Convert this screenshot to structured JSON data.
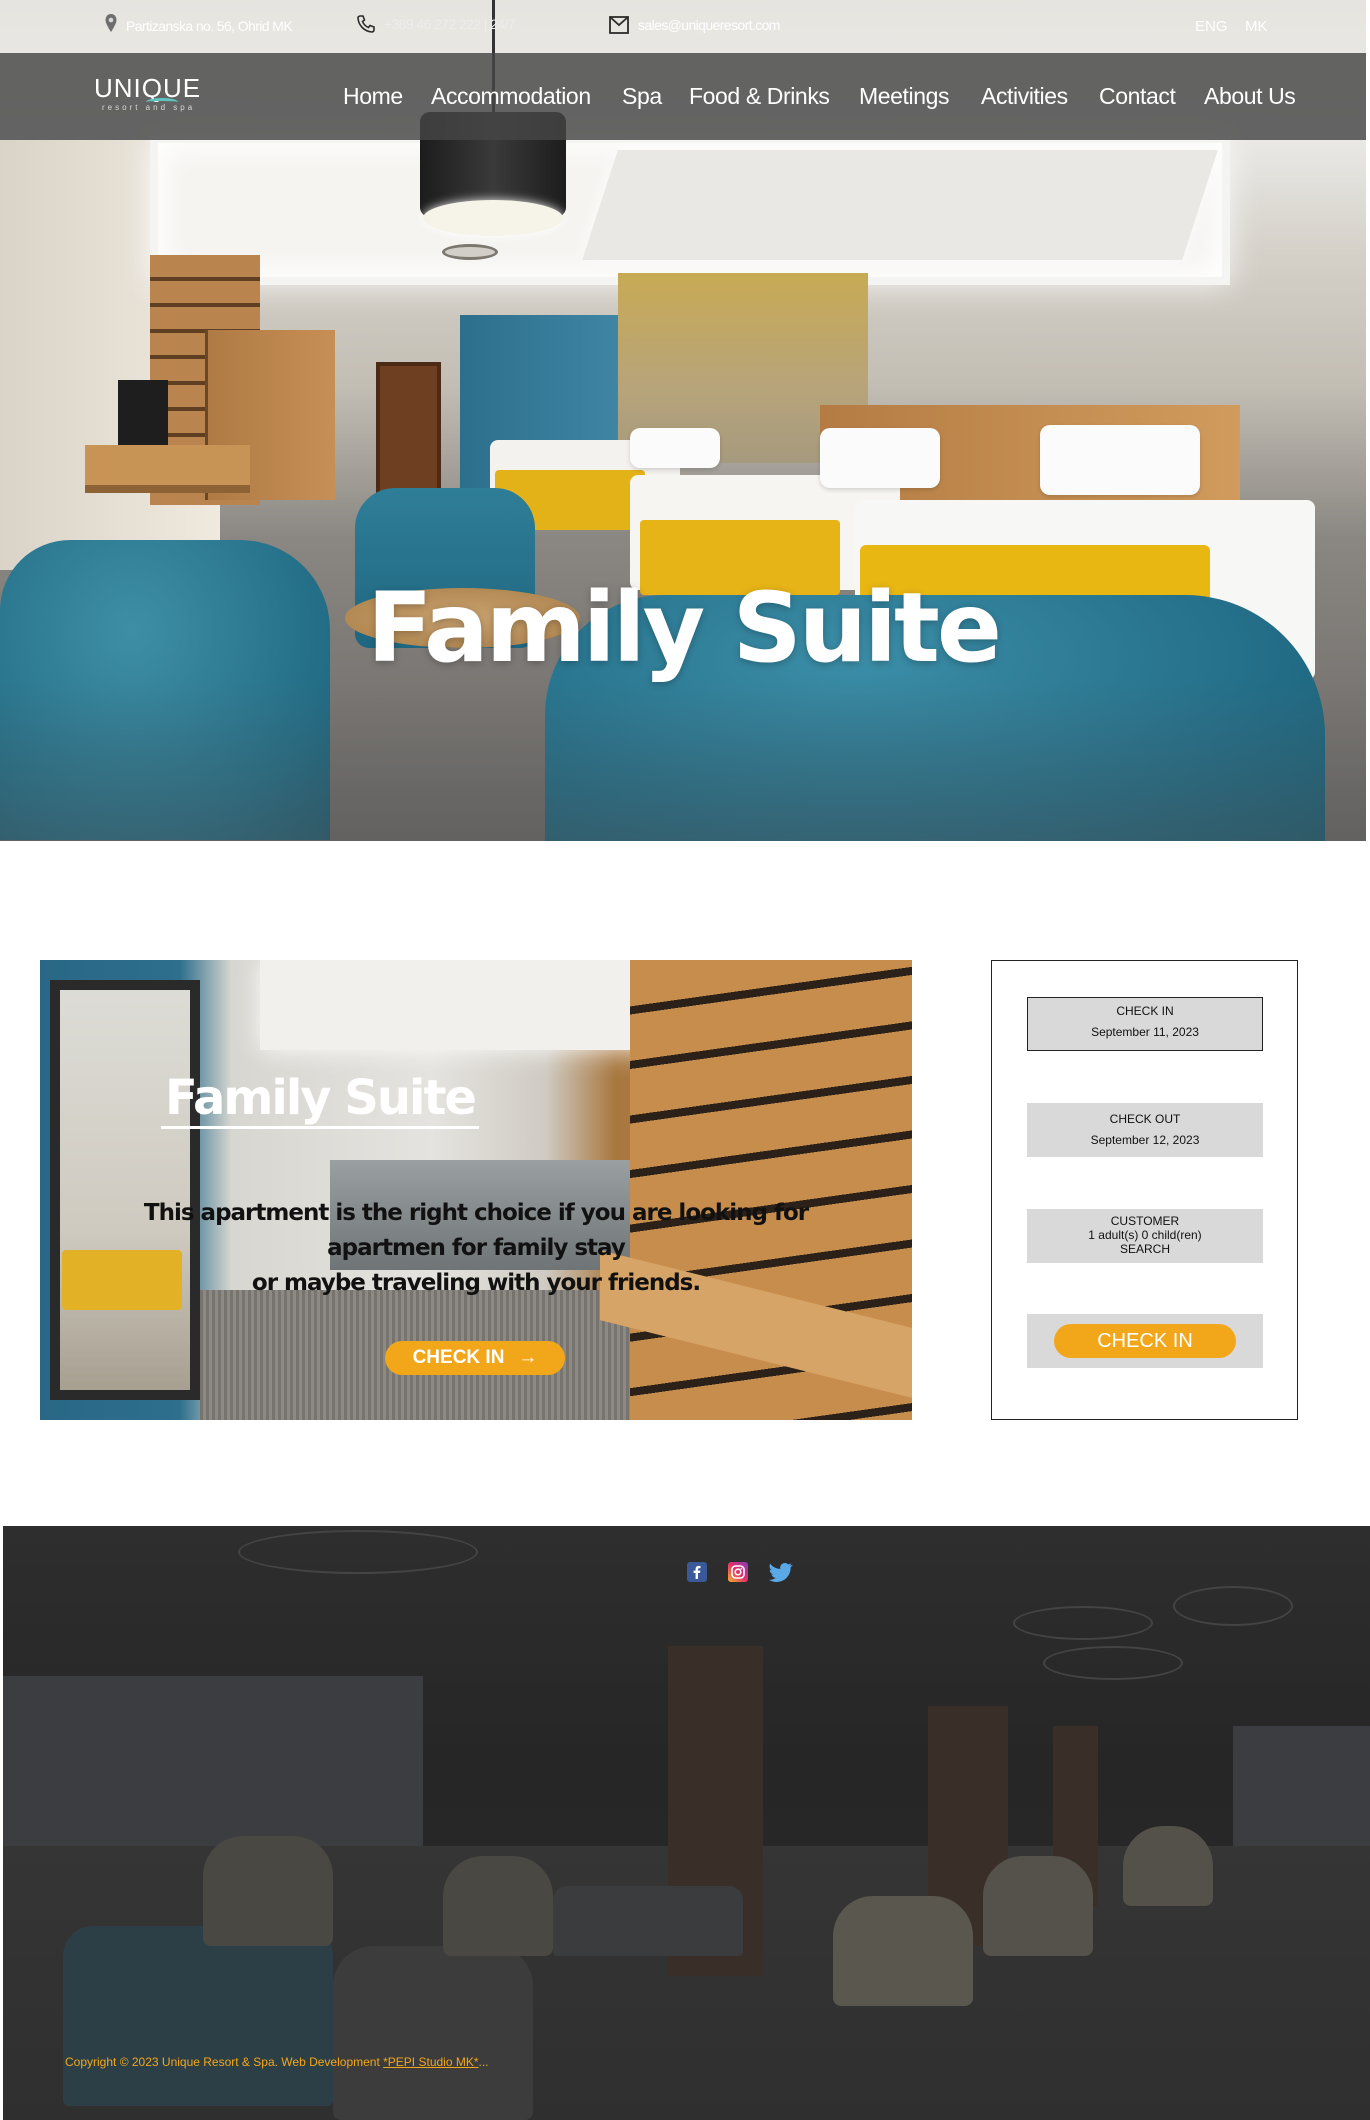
{
  "topbar": {
    "address": "Partizanska no. 56, Ohrid MK",
    "phone": "+389 46 272 222 | 24/7",
    "email": "sales@uniqueresort.com",
    "languages": [
      "ENG",
      "MK"
    ]
  },
  "logo": {
    "name": "UNIQUE",
    "tagline": "resort and spa"
  },
  "nav": {
    "items": [
      "Home",
      "Accommodation",
      "Spa",
      "Food & Drinks",
      "Meetings",
      "Activities",
      "Contact",
      "About Us"
    ]
  },
  "hero": {
    "title": "Family Suite"
  },
  "room": {
    "title": "Family Suite",
    "description_lines": [
      "This apartment is the right choice if you are looking for",
      "apartmen for family stay",
      "or maybe traveling with your friends."
    ],
    "button_label": "CHECK IN",
    "button_arrow": "→"
  },
  "booking": {
    "check_in_label": "CHECK IN",
    "check_in_value": "September 11, 2023",
    "check_out_label": "CHECK OUT",
    "check_out_value": "September 12, 2023",
    "customer_label": "CUSTOMER",
    "customer_value": "1 adult(s) 0 child(ren)",
    "search_label": "SEARCH",
    "submit_label": "CHECK IN"
  },
  "footer": {
    "social": [
      "facebook-icon",
      "instagram-icon",
      "twitter-icon"
    ],
    "copyright_text": "Copyright © 2023 Unique Resort & Spa. Web Development ",
    "developer_link": "*PEPI Studio MK*",
    "copyright_suffix": "..."
  },
  "colors": {
    "accent": "#f2a71b",
    "navbar": "#464646",
    "footer": "#2a2a2a",
    "social_facebook": "#3b5998",
    "social_twitter": "#1da1f2"
  }
}
